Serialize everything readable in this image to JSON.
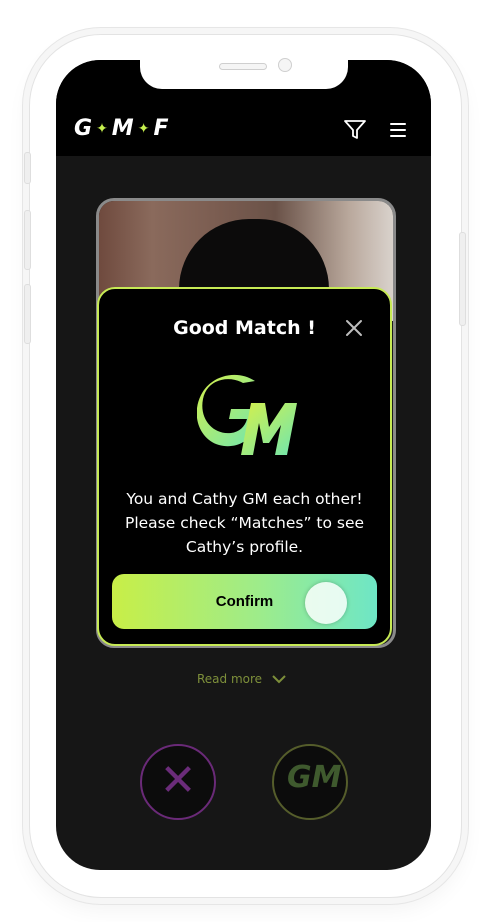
{
  "app": {
    "logo_left": "G",
    "logo_mid": "M",
    "logo_right": "F",
    "logo_star": "✦"
  },
  "header": {
    "filter_icon": "filter-icon",
    "menu_icon": "hamburger-menu-icon"
  },
  "background": {
    "read_more_label": "Read more"
  },
  "actions": {
    "reject_icon": "close-x-icon",
    "like_label": "GM"
  },
  "modal": {
    "title": "Good Match !",
    "close_icon": "close-icon",
    "message_line1": "You and Cathy GM each other!",
    "message_line2": "Please check “Matches” to see",
    "message_line3": "Cathy’s profile.",
    "confirm_label": "Confirm"
  },
  "colors": {
    "accent": "#c7ea55",
    "gradient_start": "#c8ee47",
    "gradient_end": "#6ee6c6",
    "reject_purple": "#6b2c7a",
    "screen_bg": "#161616"
  }
}
